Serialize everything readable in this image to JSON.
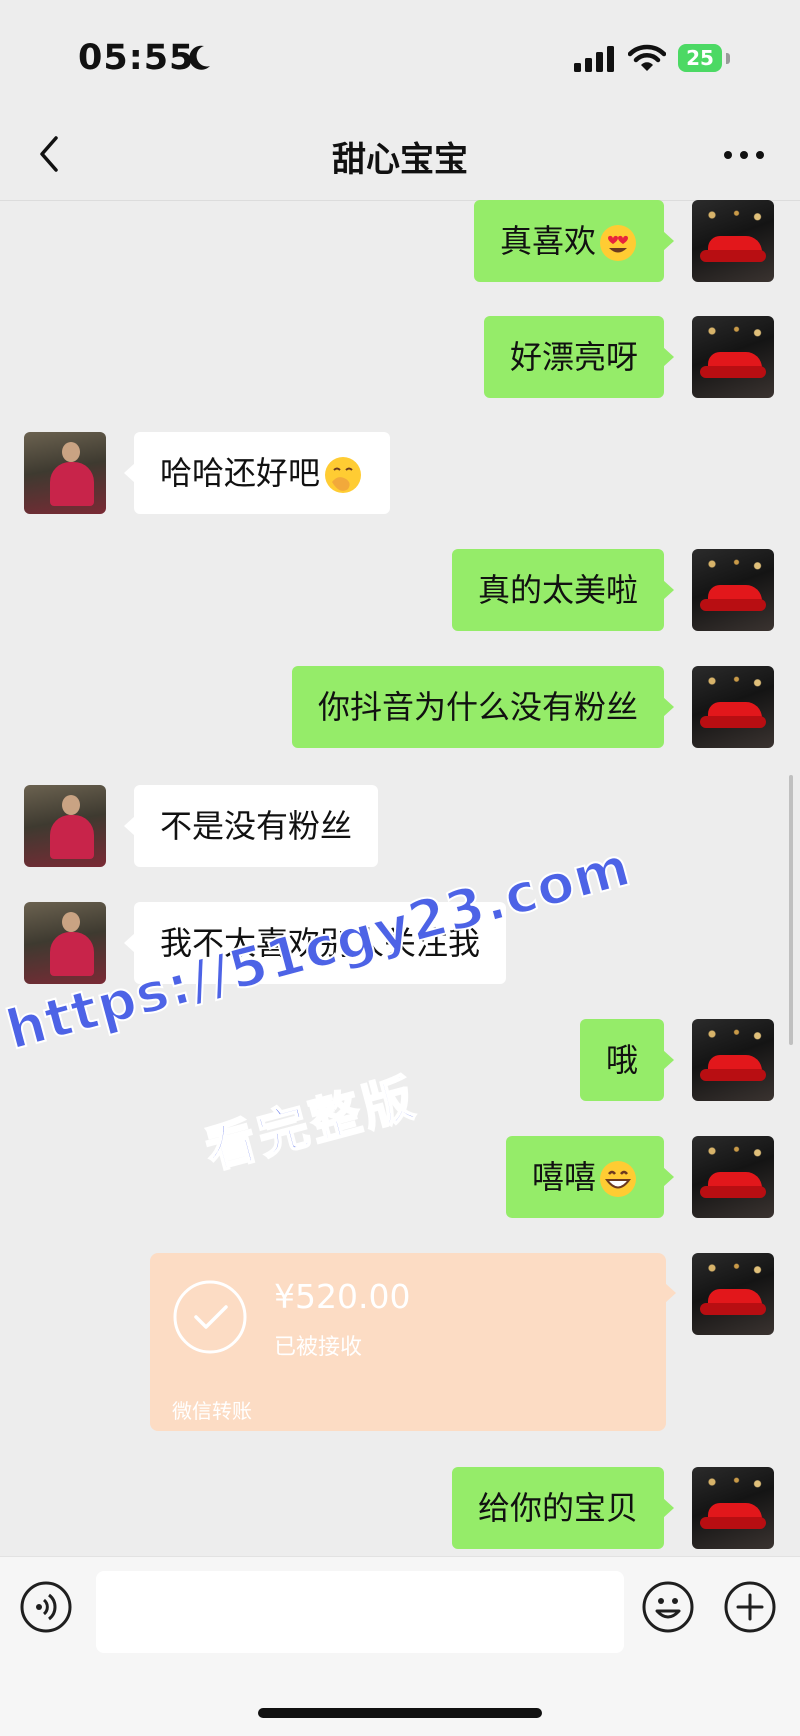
{
  "status_bar": {
    "time": "05:55",
    "battery": "25"
  },
  "header": {
    "title": "甜心宝宝"
  },
  "messages": [
    {
      "side": "out",
      "text": "真喜欢",
      "emoji": "heart-eyes-emoji"
    },
    {
      "side": "out",
      "text": "好漂亮呀"
    },
    {
      "side": "in",
      "text": "哈哈还好吧",
      "emoji": "hand-over-mouth-emoji"
    },
    {
      "side": "out",
      "text": "真的太美啦"
    },
    {
      "side": "out",
      "text": "你抖音为什么没有粉丝"
    },
    {
      "side": "in",
      "text": "不是没有粉丝"
    },
    {
      "side": "in",
      "text": "我不太喜欢别人关注我"
    },
    {
      "side": "out",
      "text": "哦"
    },
    {
      "side": "out",
      "text": "嘻嘻",
      "emoji": "grinning-emoji"
    },
    {
      "side": "out",
      "text": "给你的宝贝"
    }
  ],
  "transfer": {
    "amount": "¥520.00",
    "status": "已被接收",
    "label": "微信转账"
  },
  "watermark": {
    "line1": "https://51cgy23.com",
    "line2": "看完整版"
  },
  "colors": {
    "out_bubble": "#95ec69",
    "in_bubble": "#ffffff",
    "transfer_card": "#fcdcc4",
    "background": "#ededed"
  }
}
